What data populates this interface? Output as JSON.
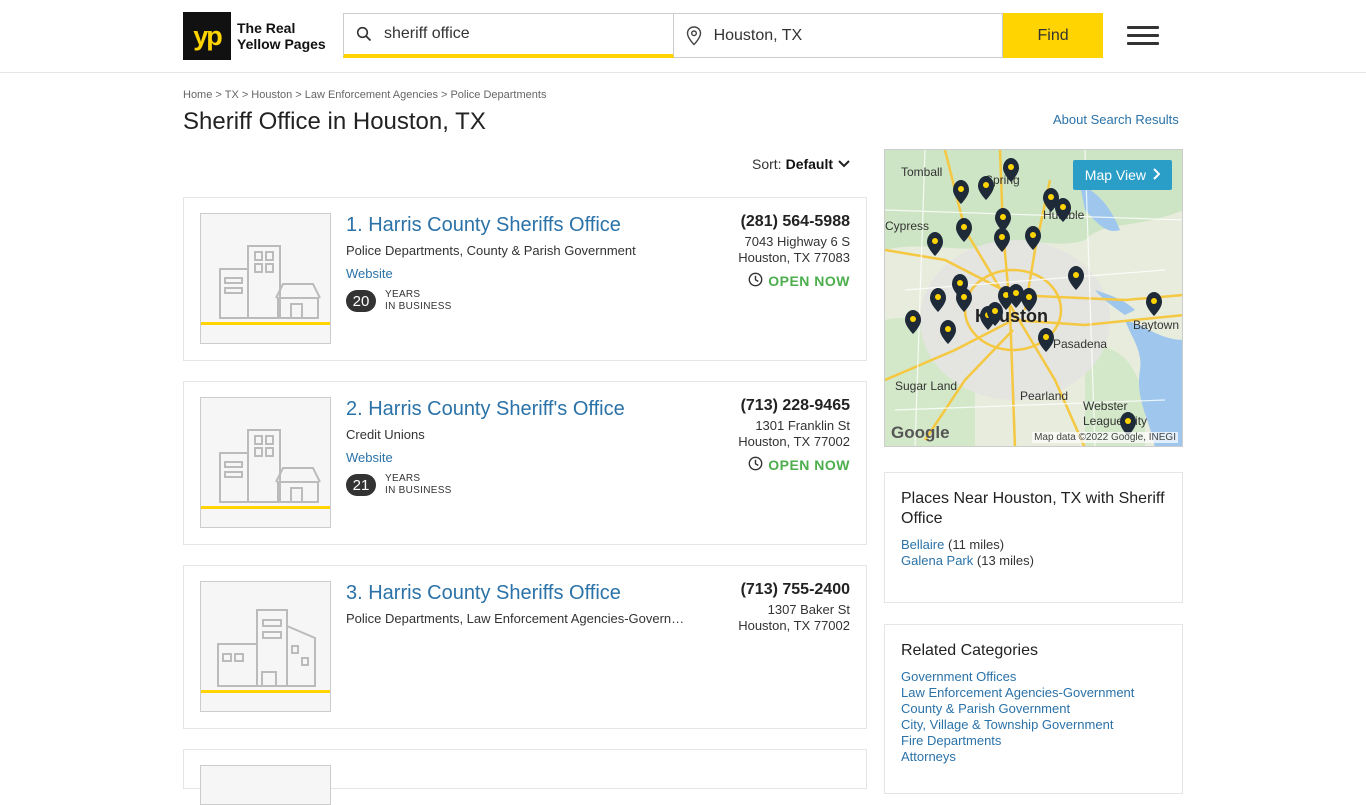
{
  "header": {
    "logo_mark": "yp",
    "logo_text_line1": "The Real",
    "logo_text_line2": "Yellow Pages",
    "search_value": "sheriff office",
    "location_value": "Houston, TX",
    "find_label": "Find"
  },
  "breadcrumb": [
    "Home",
    "TX",
    "Houston",
    "Law Enforcement Agencies",
    "Police Departments"
  ],
  "page_title": "Sheriff Office in Houston, TX",
  "about_link": "About Search Results",
  "sort": {
    "label": "Sort:",
    "value": "Default"
  },
  "listings": [
    {
      "name": "1. Harris County Sheriffs Office",
      "categories": "Police Departments, County & Parish Government",
      "website": "Website",
      "years": "20",
      "years_label_1": "YEARS",
      "years_label_2": "IN BUSINESS",
      "phone": "(281) 564-5988",
      "street": "7043 Highway 6 S",
      "city": "Houston, TX 77083",
      "status": "OPEN NOW"
    },
    {
      "name": "2. Harris County Sheriff's Office",
      "categories": "Credit Unions",
      "website": "Website",
      "years": "21",
      "years_label_1": "YEARS",
      "years_label_2": "IN BUSINESS",
      "phone": "(713) 228-9465",
      "street": "1301 Franklin St",
      "city": "Houston, TX 77002",
      "status": "OPEN NOW"
    },
    {
      "name": "3. Harris County Sheriffs Office",
      "categories": "Police Departments, Law Enforcement Agencies-Government",
      "phone": "(713) 755-2400",
      "street": "1307 Baker St",
      "city": "Houston, TX 77002"
    }
  ],
  "map": {
    "button": "Map View",
    "google": "Google",
    "credit": "Map data ©2022 Google, INEGI",
    "labels": [
      "Tomball",
      "Spring",
      "Humble",
      "Cypress",
      "Houston",
      "Baytown",
      "Pasadena",
      "Sugar Land",
      "Pearland",
      "Webster",
      "League City"
    ]
  },
  "places_near": {
    "title": "Places Near Houston, TX with Sheriff Office",
    "items": [
      {
        "name": "Bellaire",
        "distance": "(11 miles)"
      },
      {
        "name": "Galena Park",
        "distance": "(13 miles)"
      }
    ]
  },
  "related": {
    "title": "Related Categories",
    "items": [
      "Government Offices",
      "Law Enforcement Agencies-Government",
      "County & Parish Government",
      "City, Village & Township Government",
      "Fire Departments",
      "Attorneys"
    ]
  },
  "colors": {
    "brand_yellow": "#ffd400",
    "link_blue": "#2a72a8",
    "open_green": "#4cae4c",
    "map_button": "#2a9ec7"
  },
  "icons": [
    "search-icon",
    "location-pin-icon",
    "hamburger-menu-icon",
    "chevron-down-icon",
    "clock-icon",
    "chevron-right-icon",
    "building-placeholder-icon"
  ]
}
